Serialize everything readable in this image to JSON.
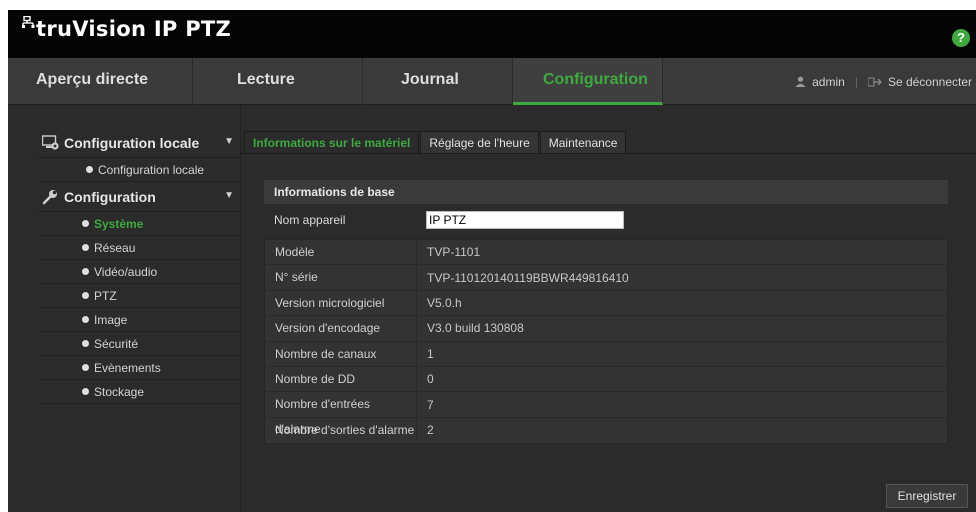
{
  "header": {
    "app_title": "truVision IP PTZ",
    "help_label": "?"
  },
  "nav": {
    "tabs": [
      {
        "label": "Aperçu directe"
      },
      {
        "label": "Lecture"
      },
      {
        "label": "Journal"
      },
      {
        "label": "Configuration",
        "active": true
      }
    ],
    "user": "admin",
    "logout": "Se déconnecter"
  },
  "sidebar": {
    "local_section": "Configuration locale",
    "local_items": [
      "Configuration locale"
    ],
    "config_section": "Configuration",
    "config_items": [
      "Système",
      "Réseau",
      "Vidéo/audio",
      "PTZ",
      "Image",
      "Sécurité",
      "Evènements",
      "Stockage"
    ],
    "active_item": "Système"
  },
  "subtabs": [
    "Informations sur le matériel",
    "Réglage de l'heure",
    "Maintenance"
  ],
  "basic_info": {
    "section_title": "Informations de base",
    "device_name_label": "Nom appareil",
    "device_name_value": "IP PTZ",
    "rows": [
      {
        "label": "Modèle",
        "value": "TVP-1101"
      },
      {
        "label": "N° série",
        "value": "TVP-110120140119BBWR449816410"
      },
      {
        "label": "Version micrologiciel",
        "value": "V5.0.h"
      },
      {
        "label": "Version d'encodage",
        "value": "V3.0 build 130808"
      },
      {
        "label": "Nombre de canaux",
        "value": "1"
      },
      {
        "label": "Nombre de DD",
        "value": "0"
      },
      {
        "label": "Nombre d'entrées d'alarme",
        "value": "7"
      },
      {
        "label": "Nombre d'sorties d'alarme",
        "value": "2"
      }
    ]
  },
  "buttons": {
    "save": "Enregistrer"
  },
  "colors": {
    "accent": "#3fa940",
    "topbar": "#050505",
    "background": "#2b2b2b"
  },
  "icons": {
    "logo": "network-logo-icon",
    "help": "help-icon",
    "user": "user-icon",
    "logout": "logout-icon",
    "local": "computer-settings-icon",
    "config": "wrench-icon",
    "bullet": "bullet-icon"
  }
}
